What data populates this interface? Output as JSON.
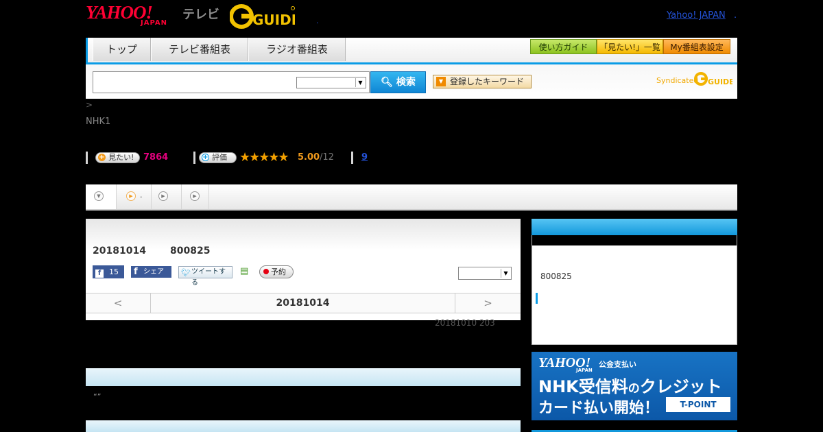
{
  "header": {
    "yahoo_logo": "YAHOO!",
    "japan_logo": "JAPAN",
    "tv_label": "テレビ",
    "gguide_logo": "G-GUIDE",
    "yahoo_japan_link": "Yahoo! JAPAN",
    "dot": "."
  },
  "nav": {
    "tabs": [
      "トップ",
      "テレビ番組表",
      "ラジオ番組表"
    ],
    "buttons": [
      "使い方ガイド",
      "「見たい!」一覧",
      "My番組表設定"
    ]
  },
  "search": {
    "input_value": "",
    "select_value": "",
    "search_label": "検索",
    "keyword_label": "登録したキーワード",
    "syndicated": "Syndicated"
  },
  "breadcrumb": ">",
  "channel": "NHK1",
  "stats": {
    "want_label": "見たい!",
    "want_count": "7864",
    "rate_label": "評価",
    "stars": "★★★★★",
    "score": "5.00",
    "score_total": "/12",
    "link_count": "9"
  },
  "tabs": {
    "second_tab_label": "."
  },
  "program": {
    "date": "20181014",
    "id": "800825",
    "fb_count": "15",
    "fb_share": "シェア",
    "tweet": "ツイートする",
    "reserve": "予約",
    "select_value": "",
    "prev": "<",
    "next": ">",
    "pager_date": "20181014",
    "note": "20181010  203",
    "quote": "“”"
  },
  "right": {
    "id": "800825"
  },
  "banner": {
    "yahoo": "YAHOO!",
    "japan": "JAPAN",
    "pay": "公金支払い",
    "line1_main": "NHK受信料",
    "line1_small": "の",
    "line1_tail": "クレジット",
    "line2": "カード払い開始！",
    "tpoint": "T-POINT"
  },
  "colors": {
    "brand_blue": "#0a9ce6",
    "yahoo_red": "#ff0033",
    "want_pink": "#e4007f",
    "star_orange": "#f2a000",
    "link_blue": "#2452d8"
  },
  "icons": [
    "search-icon",
    "facebook-icon",
    "twitter-icon",
    "play-icon",
    "record-dot-icon",
    "add-list-icon",
    "dropdown-arrow-icon"
  ]
}
